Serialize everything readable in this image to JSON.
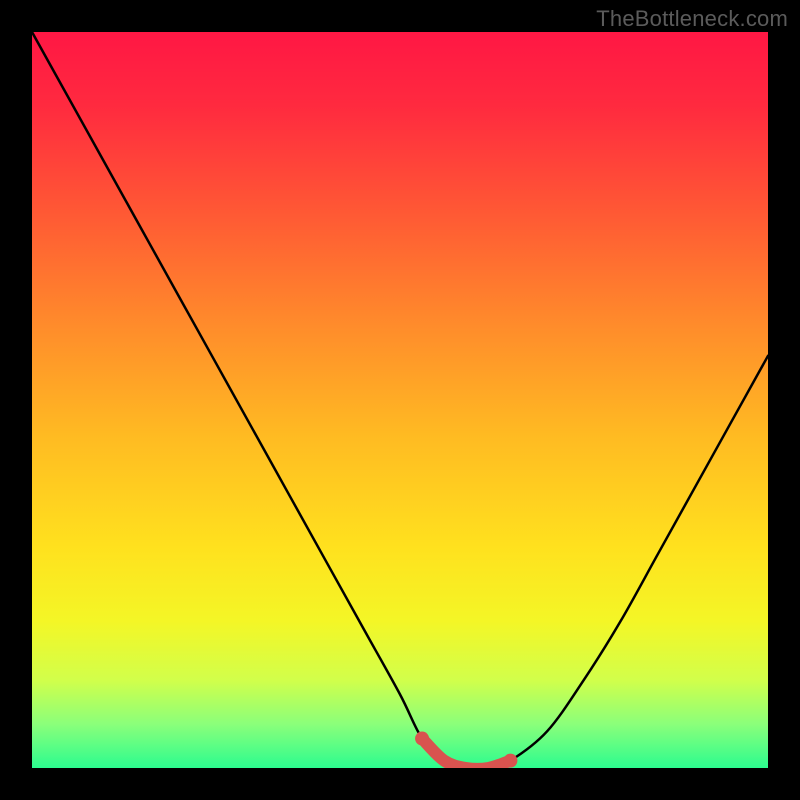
{
  "watermark": "TheBottleneck.com",
  "chart_data": {
    "type": "line",
    "title": "",
    "xlabel": "",
    "ylabel": "",
    "xlim": [
      0,
      100
    ],
    "ylim": [
      0,
      100
    ],
    "series": [
      {
        "name": "bottleneck-curve",
        "x": [
          0,
          5,
          10,
          15,
          20,
          25,
          30,
          35,
          40,
          45,
          50,
          53,
          56,
          59,
          62,
          65,
          70,
          75,
          80,
          85,
          90,
          95,
          100
        ],
        "y": [
          100,
          91,
          82,
          73,
          64,
          55,
          46,
          37,
          28,
          19,
          10,
          4,
          1,
          0,
          0,
          1,
          5,
          12,
          20,
          29,
          38,
          47,
          56
        ]
      }
    ],
    "highlight_region": {
      "name": "sweet-spot",
      "x_start": 53,
      "x_end": 65,
      "y": 0
    },
    "background_gradient_stops": [
      {
        "pos": 0.0,
        "color": "#ff1744"
      },
      {
        "pos": 0.1,
        "color": "#ff2a3f"
      },
      {
        "pos": 0.25,
        "color": "#ff5a34"
      },
      {
        "pos": 0.4,
        "color": "#ff8c2b"
      },
      {
        "pos": 0.55,
        "color": "#ffbb22"
      },
      {
        "pos": 0.7,
        "color": "#ffe11e"
      },
      {
        "pos": 0.8,
        "color": "#f4f626"
      },
      {
        "pos": 0.88,
        "color": "#d2ff4a"
      },
      {
        "pos": 0.94,
        "color": "#8bff7a"
      },
      {
        "pos": 1.0,
        "color": "#2cfc8f"
      }
    ],
    "highlight_color": "#d9534f"
  }
}
